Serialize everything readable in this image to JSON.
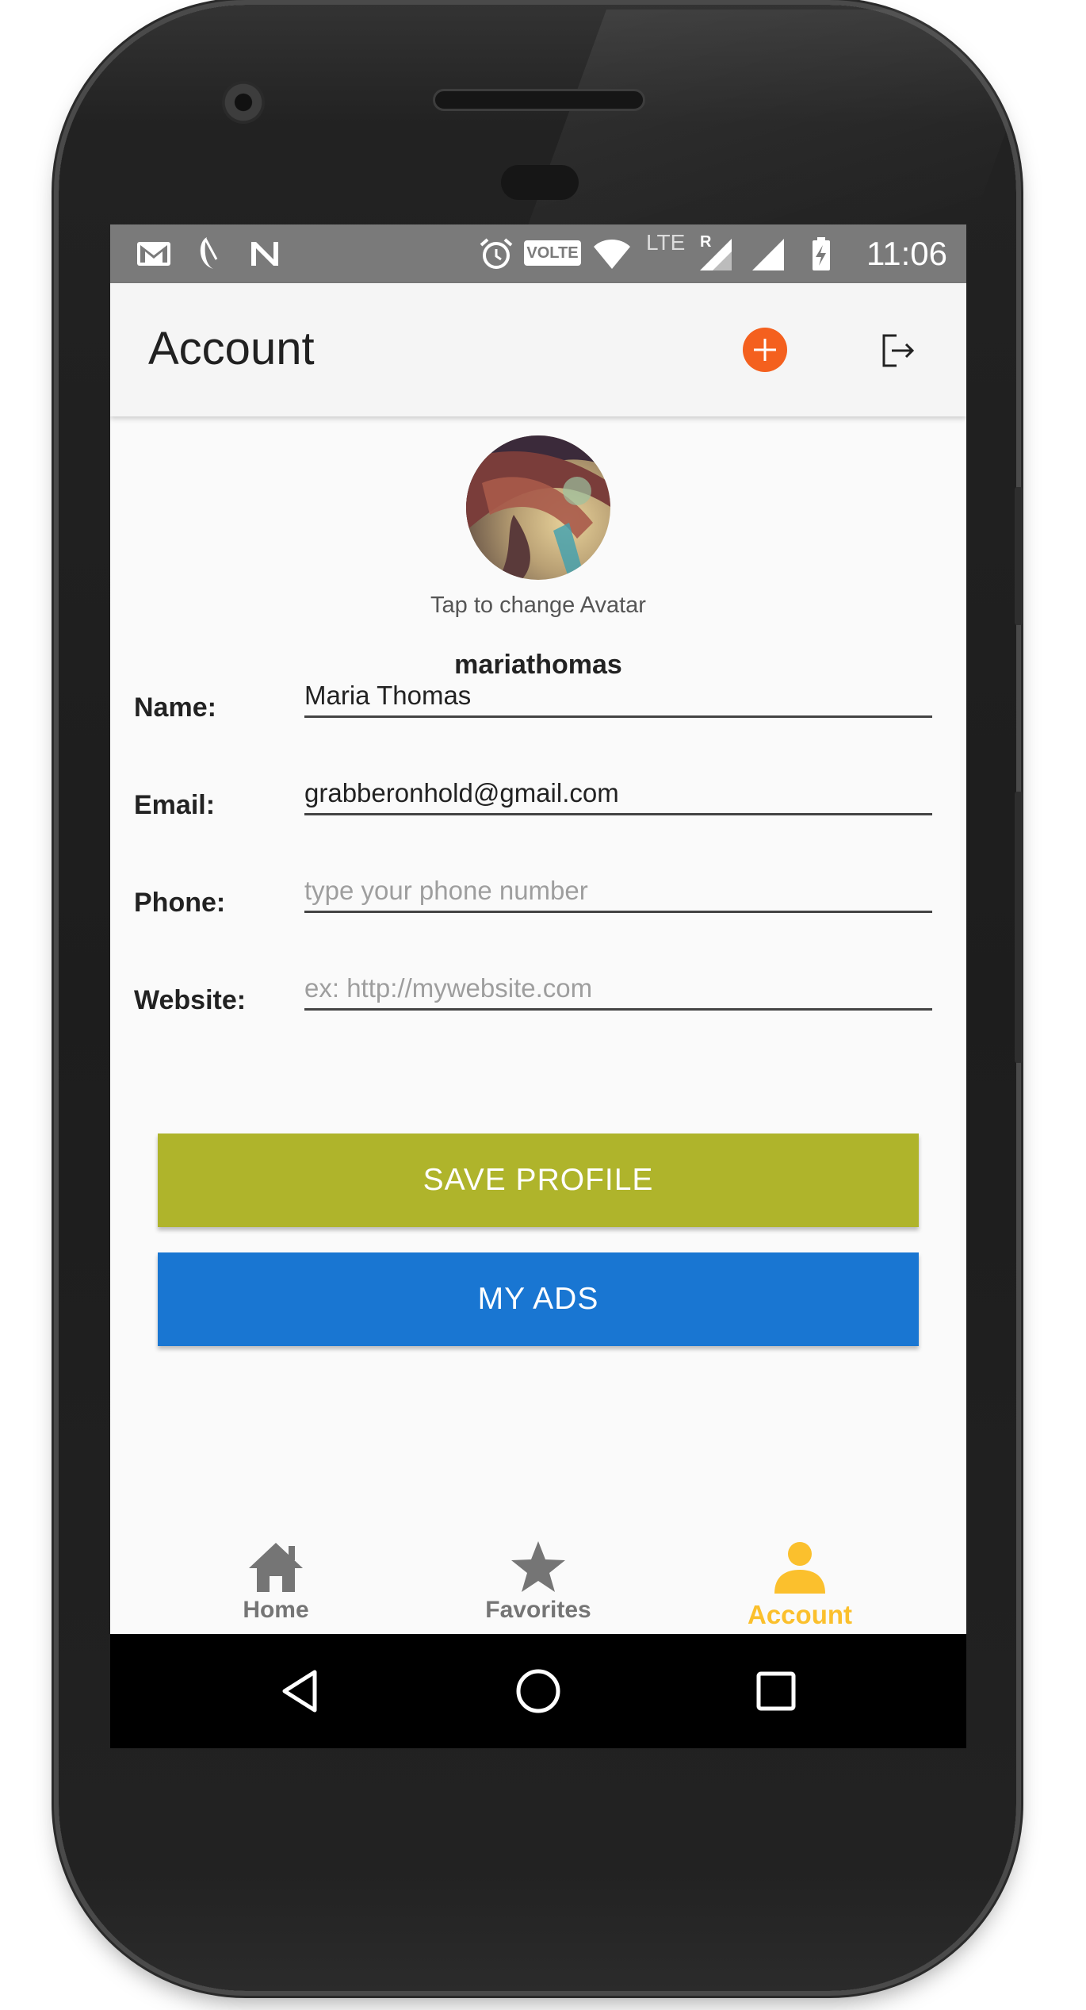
{
  "status_bar": {
    "time": "11:06",
    "volte_label": "VOLTE",
    "lte_label": "LTE",
    "roaming_label": "R",
    "icons": [
      "gmail-icon",
      "moon-icon",
      "n-icon",
      "alarm-icon",
      "volte-icon",
      "wifi-icon",
      "signal-icon",
      "signal-icon",
      "battery-charging-icon"
    ]
  },
  "app_bar": {
    "title": "Account",
    "actions": [
      "add-icon",
      "logout-icon"
    ],
    "add_color": "#f4601e"
  },
  "profile": {
    "avatar_hint": "Tap to change Avatar",
    "username": "mariathomas"
  },
  "form": {
    "name": {
      "label": "Name:",
      "value": "Maria Thomas",
      "placeholder": ""
    },
    "email": {
      "label": "Email:",
      "value": "grabberonhold@gmail.com",
      "placeholder": ""
    },
    "phone": {
      "label": "Phone:",
      "value": "",
      "placeholder": "type your phone number"
    },
    "website": {
      "label": "Website:",
      "value": "",
      "placeholder": "ex: http://mywebsite.com"
    }
  },
  "buttons": {
    "save": {
      "label": "SAVE PROFILE",
      "color": "#afb42b"
    },
    "my_ads": {
      "label": "MY ADS",
      "color": "#1976d2"
    }
  },
  "bottom_nav": {
    "items": [
      {
        "label": "Home",
        "icon": "home-icon",
        "active": false
      },
      {
        "label": "Favorites",
        "icon": "star-icon",
        "active": false
      },
      {
        "label": "Account",
        "icon": "person-icon",
        "active": true
      }
    ],
    "inactive_color": "#757575",
    "active_color": "#fbc02d"
  },
  "system_nav": [
    "back-icon",
    "home-circle-icon",
    "recents-icon"
  ]
}
